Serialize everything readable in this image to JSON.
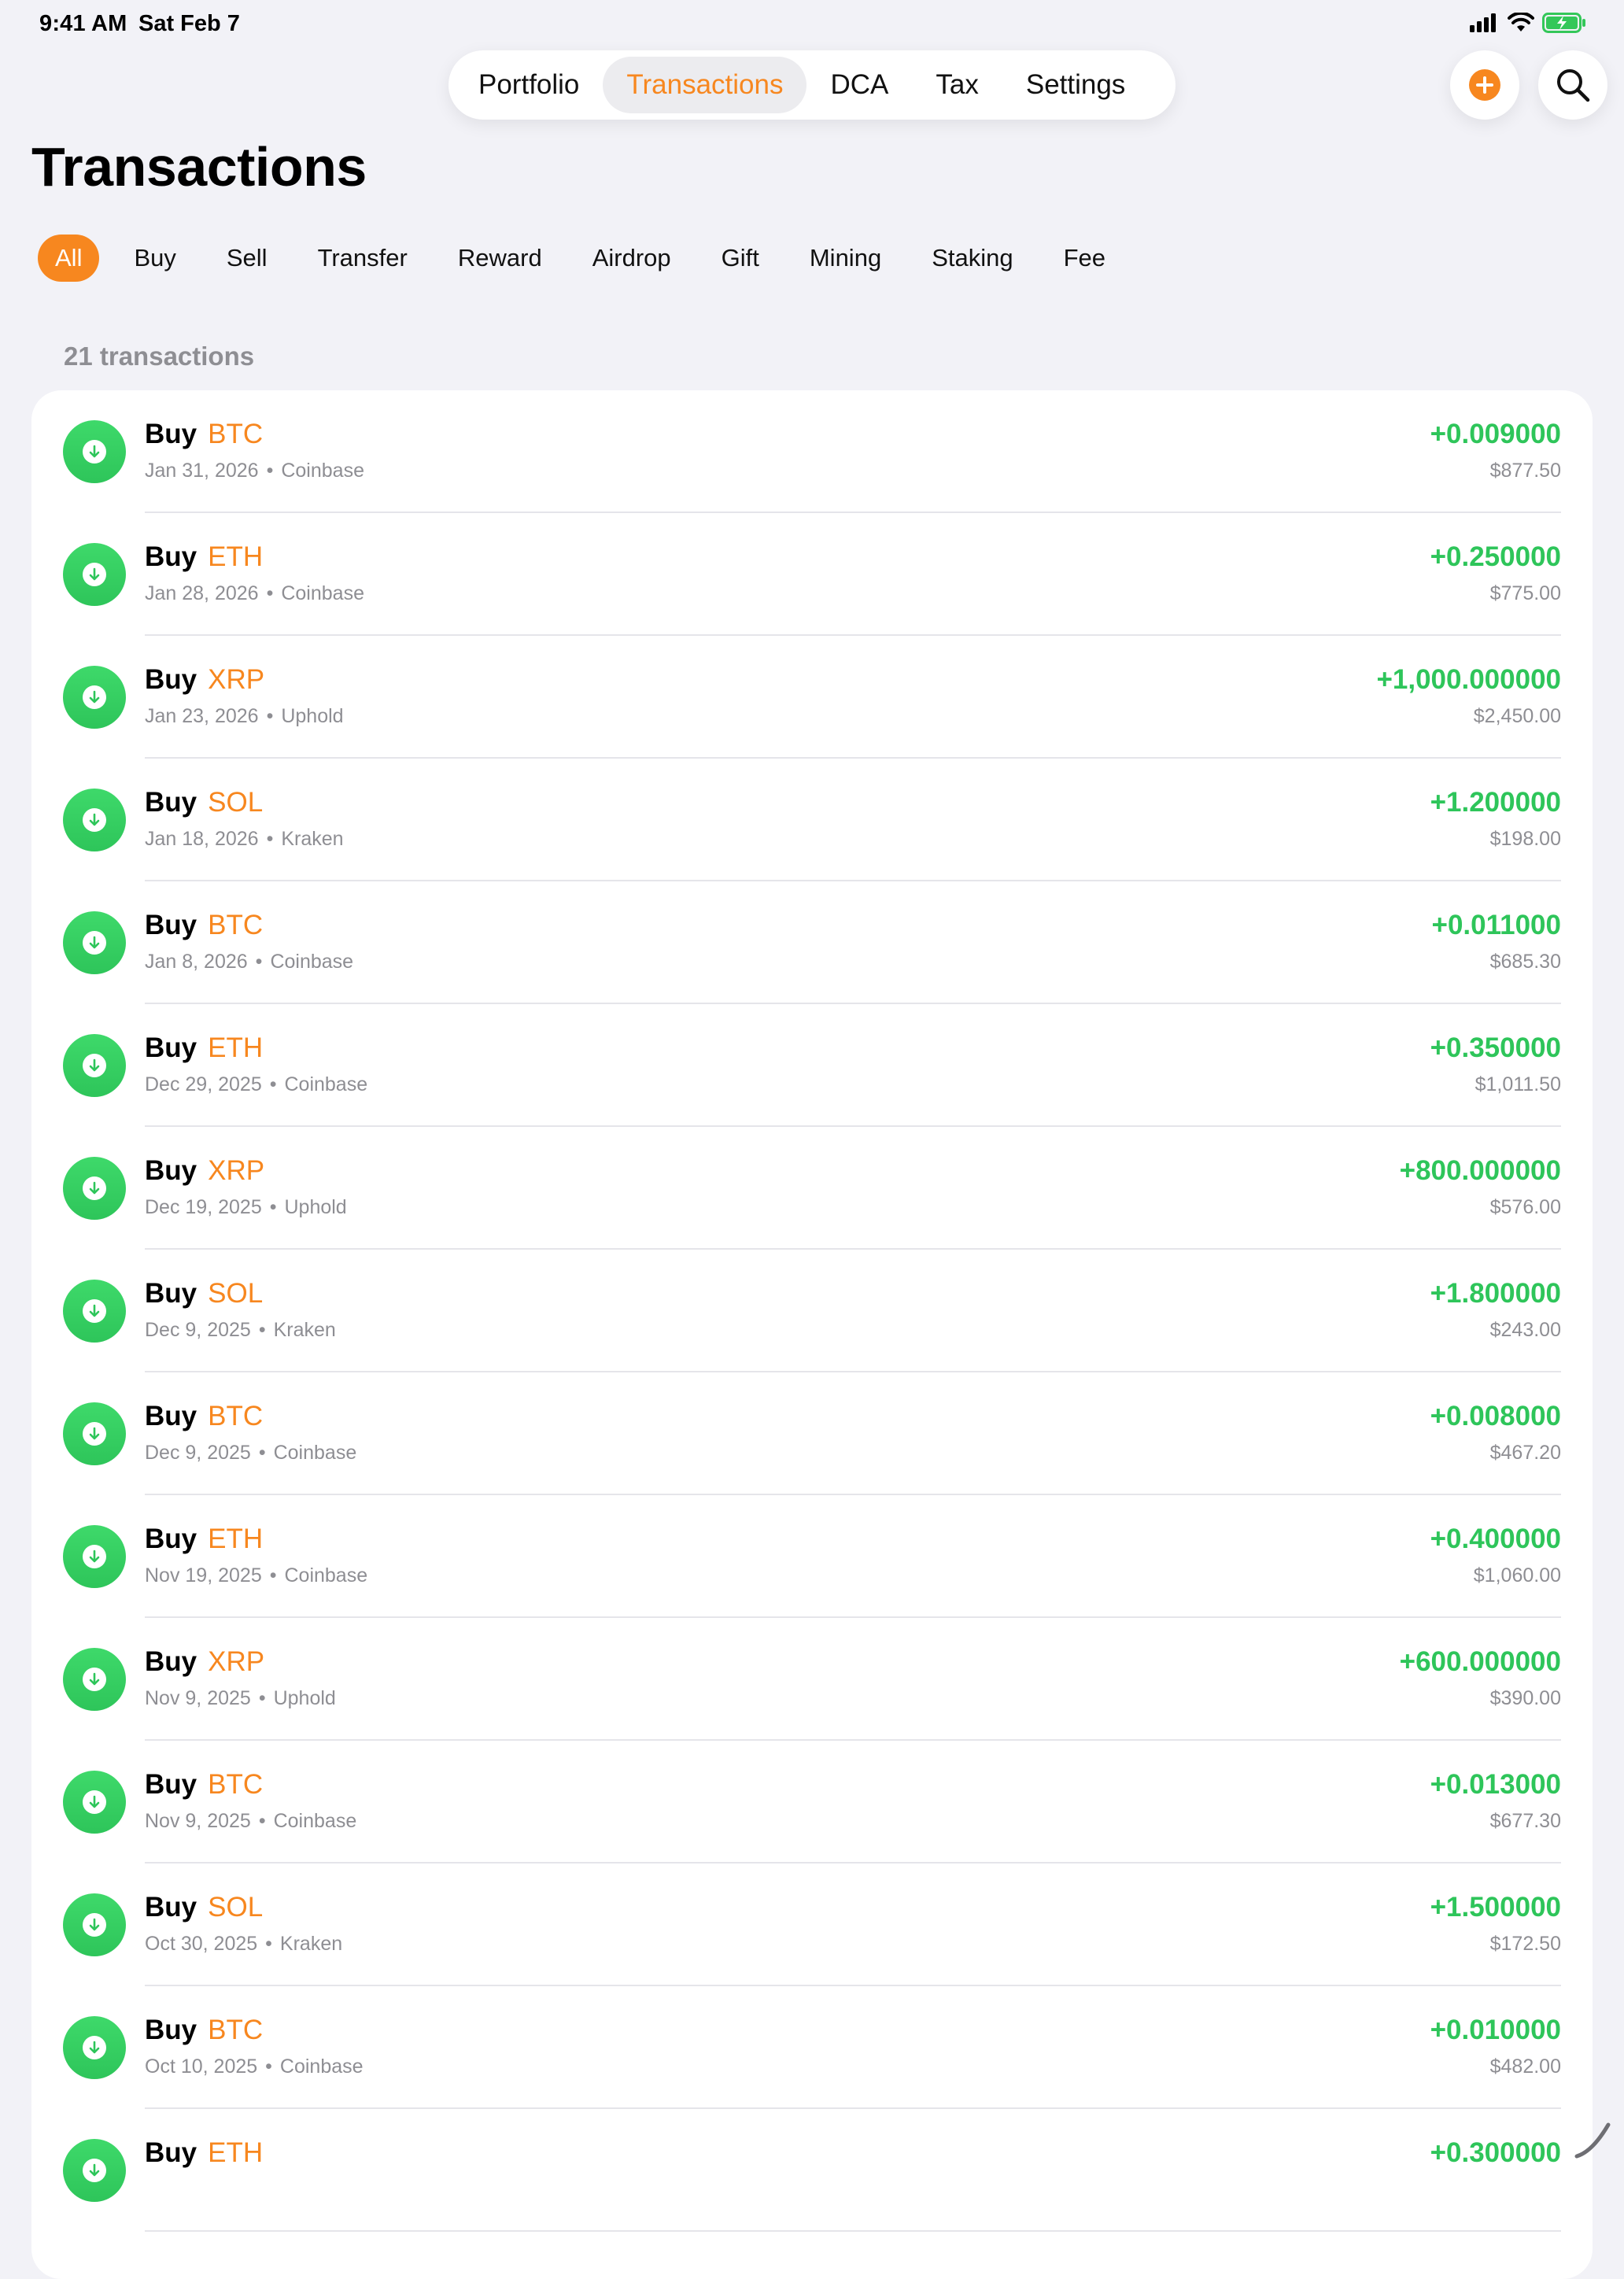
{
  "status": {
    "time": "9:41 AM",
    "date": "Sat Feb 7"
  },
  "tabs": [
    {
      "label": "Portfolio",
      "active": false
    },
    {
      "label": "Transactions",
      "active": true
    },
    {
      "label": "DCA",
      "active": false
    },
    {
      "label": "Tax",
      "active": false
    },
    {
      "label": "Settings",
      "active": false
    }
  ],
  "page_title": "Transactions",
  "filters": [
    "All",
    "Buy",
    "Sell",
    "Transfer",
    "Reward",
    "Airdrop",
    "Gift",
    "Mining",
    "Staking",
    "Fee"
  ],
  "selected_filter": "All",
  "count_label": "21 transactions",
  "colors": {
    "accent": "#f7871f",
    "positive": "#2ec55a",
    "secondary_text": "#8e8e93",
    "background": "#f2f2f7"
  },
  "icons": {
    "add": "plus-circle-icon",
    "search": "search-icon",
    "row": "arrow-down-circle-icon"
  },
  "transactions": [
    {
      "type": "Buy",
      "asset": "BTC",
      "date": "Jan 31, 2026",
      "exchange": "Coinbase",
      "amount": "+0.009000",
      "value": "$877.50"
    },
    {
      "type": "Buy",
      "asset": "ETH",
      "date": "Jan 28, 2026",
      "exchange": "Coinbase",
      "amount": "+0.250000",
      "value": "$775.00"
    },
    {
      "type": "Buy",
      "asset": "XRP",
      "date": "Jan 23, 2026",
      "exchange": "Uphold",
      "amount": "+1,000.000000",
      "value": "$2,450.00"
    },
    {
      "type": "Buy",
      "asset": "SOL",
      "date": "Jan 18, 2026",
      "exchange": "Kraken",
      "amount": "+1.200000",
      "value": "$198.00"
    },
    {
      "type": "Buy",
      "asset": "BTC",
      "date": "Jan 8, 2026",
      "exchange": "Coinbase",
      "amount": "+0.011000",
      "value": "$685.30"
    },
    {
      "type": "Buy",
      "asset": "ETH",
      "date": "Dec 29, 2025",
      "exchange": "Coinbase",
      "amount": "+0.350000",
      "value": "$1,011.50"
    },
    {
      "type": "Buy",
      "asset": "XRP",
      "date": "Dec 19, 2025",
      "exchange": "Uphold",
      "amount": "+800.000000",
      "value": "$576.00"
    },
    {
      "type": "Buy",
      "asset": "SOL",
      "date": "Dec 9, 2025",
      "exchange": "Kraken",
      "amount": "+1.800000",
      "value": "$243.00"
    },
    {
      "type": "Buy",
      "asset": "BTC",
      "date": "Dec 9, 2025",
      "exchange": "Coinbase",
      "amount": "+0.008000",
      "value": "$467.20"
    },
    {
      "type": "Buy",
      "asset": "ETH",
      "date": "Nov 19, 2025",
      "exchange": "Coinbase",
      "amount": "+0.400000",
      "value": "$1,060.00"
    },
    {
      "type": "Buy",
      "asset": "XRP",
      "date": "Nov 9, 2025",
      "exchange": "Uphold",
      "amount": "+600.000000",
      "value": "$390.00"
    },
    {
      "type": "Buy",
      "asset": "BTC",
      "date": "Nov 9, 2025",
      "exchange": "Coinbase",
      "amount": "+0.013000",
      "value": "$677.30"
    },
    {
      "type": "Buy",
      "asset": "SOL",
      "date": "Oct 30, 2025",
      "exchange": "Kraken",
      "amount": "+1.500000",
      "value": "$172.50"
    },
    {
      "type": "Buy",
      "asset": "BTC",
      "date": "Oct 10, 2025",
      "exchange": "Coinbase",
      "amount": "+0.010000",
      "value": "$482.00"
    },
    {
      "type": "Buy",
      "asset": "ETH",
      "date": "",
      "exchange": "",
      "amount": "+0.300000",
      "value": ""
    }
  ]
}
